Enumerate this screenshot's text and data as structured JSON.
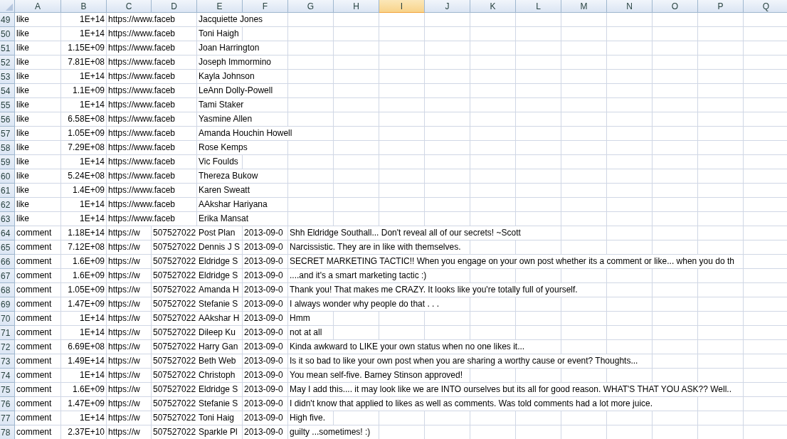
{
  "columns": [
    {
      "label": "A",
      "kind": "text",
      "selected": false
    },
    {
      "label": "B",
      "kind": "number",
      "selected": false
    },
    {
      "label": "C",
      "kind": "text",
      "selected": false
    },
    {
      "label": "D",
      "kind": "text",
      "selected": false
    },
    {
      "label": "E",
      "kind": "text",
      "selected": false
    },
    {
      "label": "F",
      "kind": "text",
      "selected": false
    },
    {
      "label": "G",
      "kind": "text",
      "selected": false
    },
    {
      "label": "H",
      "selected": false
    },
    {
      "label": "I",
      "selected": true
    },
    {
      "label": "J",
      "selected": false
    },
    {
      "label": "K",
      "selected": false
    },
    {
      "label": "L",
      "selected": false
    },
    {
      "label": "M",
      "selected": false
    },
    {
      "label": "N",
      "selected": false
    },
    {
      "label": "O",
      "selected": false
    },
    {
      "label": "P",
      "selected": false
    },
    {
      "label": "Q",
      "selected": false
    }
  ],
  "rows": [
    {
      "number": "49",
      "cells": [
        "like",
        "1E+14",
        "https://www.faceb",
        null,
        "Jacquiette Jones"
      ]
    },
    {
      "number": "50",
      "cells": [
        "like",
        "1E+14",
        "https://www.faceb",
        null,
        "Toni Haigh"
      ]
    },
    {
      "number": "51",
      "cells": [
        "like",
        "1.15E+09",
        "https://www.faceb",
        null,
        "Joan Harrington"
      ]
    },
    {
      "number": "52",
      "cells": [
        "like",
        "7.81E+08",
        "https://www.faceb",
        null,
        "Joseph Immormino"
      ]
    },
    {
      "number": "53",
      "cells": [
        "like",
        "1E+14",
        "https://www.faceb",
        null,
        "Kayla Johnson"
      ]
    },
    {
      "number": "54",
      "cells": [
        "like",
        "1.1E+09",
        "https://www.faceb",
        null,
        "LeAnn Dolly-Powell"
      ]
    },
    {
      "number": "55",
      "cells": [
        "like",
        "1E+14",
        "https://www.faceb",
        null,
        "Tami Staker"
      ]
    },
    {
      "number": "56",
      "cells": [
        "like",
        "6.58E+08",
        "https://www.faceb",
        null,
        "Yasmine Allen"
      ]
    },
    {
      "number": "57",
      "cells": [
        "like",
        "1.05E+09",
        "https://www.faceb",
        null,
        "Amanda Houchin Howell"
      ]
    },
    {
      "number": "58",
      "cells": [
        "like",
        "7.29E+08",
        "https://www.faceb",
        null,
        "Rose Kemps"
      ]
    },
    {
      "number": "59",
      "cells": [
        "like",
        "1E+14",
        "https://www.faceb",
        null,
        "Vic Foulds"
      ]
    },
    {
      "number": "60",
      "cells": [
        "like",
        "5.24E+08",
        "https://www.faceb",
        null,
        "Thereza Bukow"
      ]
    },
    {
      "number": "61",
      "cells": [
        "like",
        "1.4E+09",
        "https://www.faceb",
        null,
        "Karen Sweatt"
      ]
    },
    {
      "number": "62",
      "cells": [
        "like",
        "1E+14",
        "https://www.faceb",
        null,
        "AAkshar Hariyana"
      ]
    },
    {
      "number": "63",
      "cells": [
        "like",
        "1E+14",
        "https://www.faceb",
        null,
        "Erika Mansat"
      ]
    },
    {
      "number": "64",
      "cells": [
        "comment",
        "1.18E+14",
        "https://w",
        "507527022",
        "Post Plan",
        "2013-09-0",
        "Shh Eldridge Southall... Don't reveal all of our secrets! ~Scott"
      ]
    },
    {
      "number": "65",
      "cells": [
        "comment",
        "7.12E+08",
        "https://w",
        "507527022",
        "Dennis J S",
        "2013-09-0",
        "Narcissistic. They are in like with themselves."
      ]
    },
    {
      "number": "66",
      "cells": [
        "comment",
        "1.6E+09",
        "https://w",
        "507527022",
        "Eldridge S",
        "2013-09-0",
        "SECRET MARKETING TACTIC!! When you engage on your own post whether its a comment or like... when you do th"
      ]
    },
    {
      "number": "67",
      "cells": [
        "comment",
        "1.6E+09",
        "https://w",
        "507527022",
        "Eldridge S",
        "2013-09-0",
        "....and it's a smart marketing tactic :)"
      ]
    },
    {
      "number": "68",
      "cells": [
        "comment",
        "1.05E+09",
        "https://w",
        "507527022",
        "Amanda H",
        "2013-09-0",
        "Thank you! That makes me CRAZY. It looks like you're totally full of yourself."
      ]
    },
    {
      "number": "69",
      "cells": [
        "comment",
        "1.47E+09",
        "https://w",
        "507527022",
        "Stefanie S",
        "2013-09-0",
        "I always wonder why people do that . . ."
      ]
    },
    {
      "number": "70",
      "cells": [
        "comment",
        "1E+14",
        "https://w",
        "507527022",
        "AAkshar H",
        "2013-09-0",
        "Hmm"
      ]
    },
    {
      "number": "71",
      "cells": [
        "comment",
        "1E+14",
        "https://w",
        "507527022",
        "Dileep Ku",
        "2013-09-0",
        "not at all"
      ]
    },
    {
      "number": "72",
      "cells": [
        "comment",
        "6.69E+08",
        "https://w",
        "507527022",
        "Harry Gan",
        "2013-09-0",
        "Kinda awkward to LIKE your own status when no one likes it..."
      ]
    },
    {
      "number": "73",
      "cells": [
        "comment",
        "1.49E+14",
        "https://w",
        "507527022",
        "Beth Web",
        "2013-09-0",
        "Is it so bad to like your own post when you are sharing a worthy cause or event? Thoughts..."
      ]
    },
    {
      "number": "74",
      "cells": [
        "comment",
        "1E+14",
        "https://w",
        "507527022",
        "Christoph",
        "2013-09-0",
        "You mean self-five. Barney Stinson approved!"
      ]
    },
    {
      "number": "75",
      "cells": [
        "comment",
        "1.6E+09",
        "https://w",
        "507527022",
        "Eldridge S",
        "2013-09-0",
        "May I add this.... it may look like we are INTO ourselves but its all for good reason. WHAT'S THAT YOU ASK?? Well.."
      ]
    },
    {
      "number": "76",
      "cells": [
        "comment",
        "1.47E+09",
        "https://w",
        "507527022",
        "Stefanie S",
        "2013-09-0",
        "I didn't know that applied to likes as well as comments. Was told comments had a lot more juice."
      ]
    },
    {
      "number": "77",
      "cells": [
        "comment",
        "1E+14",
        "https://w",
        "507527022",
        "Toni Haig",
        "2013-09-0",
        "High five."
      ]
    },
    {
      "number": "78",
      "cells": [
        "comment",
        "2.37E+10",
        "https://w",
        "507527022",
        "Sparkle Pl",
        "2013-09-0",
        "guilty ...sometimes! :)"
      ]
    }
  ]
}
